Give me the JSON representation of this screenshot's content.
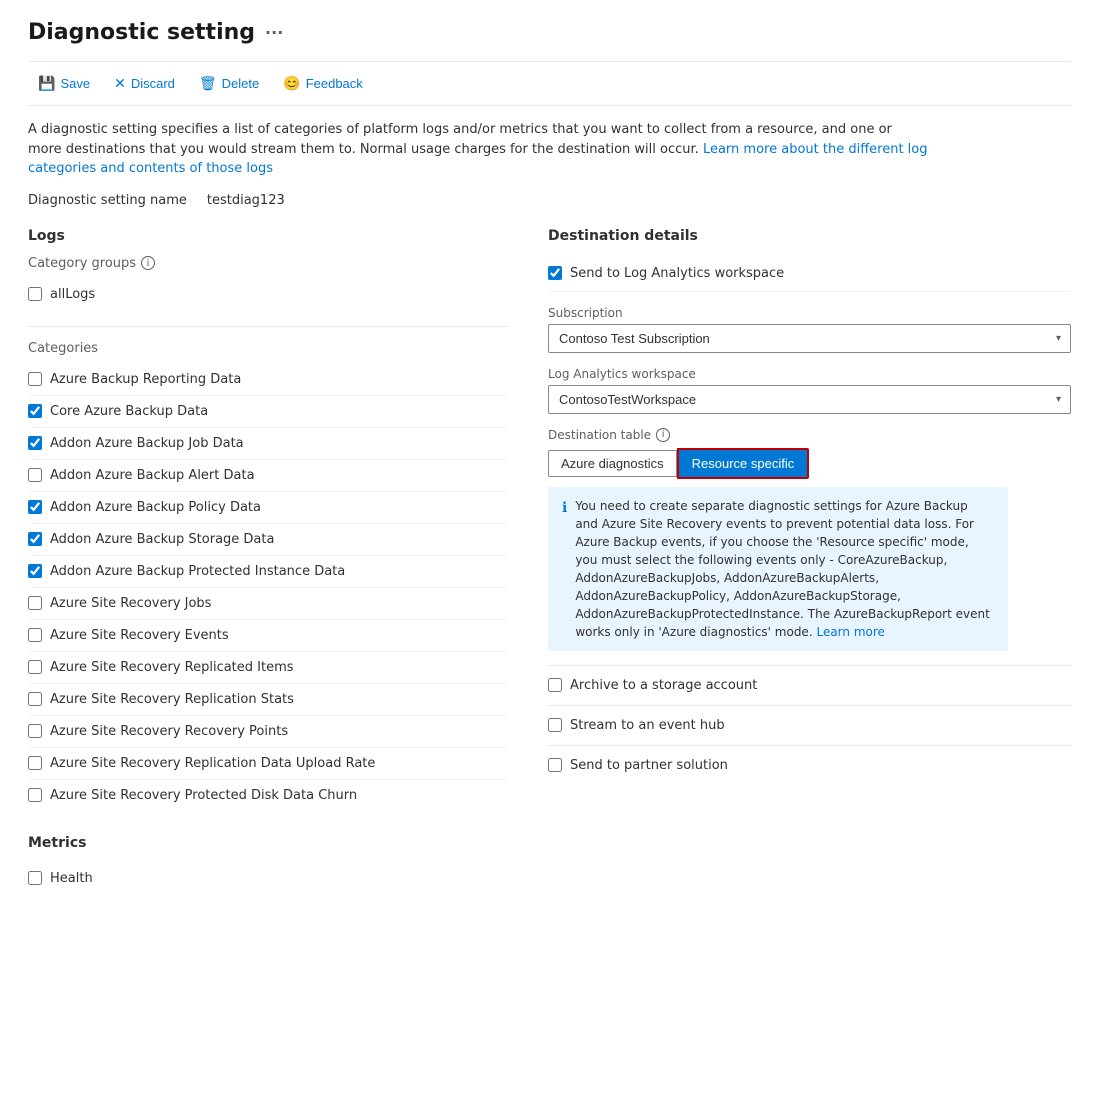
{
  "page": {
    "title": "Diagnostic setting",
    "ellipsis": "···"
  },
  "toolbar": {
    "save_label": "Save",
    "discard_label": "Discard",
    "delete_label": "Delete",
    "feedback_label": "Feedback"
  },
  "description": {
    "main_text": "A diagnostic setting specifies a list of categories of platform logs and/or metrics that you want to collect from a resource, and one or more destinations that you would stream them to. Normal usage charges for the destination will occur.",
    "link_text": "Learn more about the different log categories and contents of those logs"
  },
  "setting_name": {
    "label": "Diagnostic setting name",
    "value": "testdiag123"
  },
  "logs": {
    "section_title": "Logs",
    "category_groups_label": "Category groups",
    "all_logs_label": "allLogs",
    "all_logs_checked": false,
    "categories_label": "Categories",
    "categories": [
      {
        "id": "cat1",
        "label": "Azure Backup Reporting Data",
        "checked": false
      },
      {
        "id": "cat2",
        "label": "Core Azure Backup Data",
        "checked": true
      },
      {
        "id": "cat3",
        "label": "Addon Azure Backup Job Data",
        "checked": true
      },
      {
        "id": "cat4",
        "label": "Addon Azure Backup Alert Data",
        "checked": false
      },
      {
        "id": "cat5",
        "label": "Addon Azure Backup Policy Data",
        "checked": true
      },
      {
        "id": "cat6",
        "label": "Addon Azure Backup Storage Data",
        "checked": true
      },
      {
        "id": "cat7",
        "label": "Addon Azure Backup Protected Instance Data",
        "checked": true
      },
      {
        "id": "cat8",
        "label": "Azure Site Recovery Jobs",
        "checked": false
      },
      {
        "id": "cat9",
        "label": "Azure Site Recovery Events",
        "checked": false
      },
      {
        "id": "cat10",
        "label": "Azure Site Recovery Replicated Items",
        "checked": false
      },
      {
        "id": "cat11",
        "label": "Azure Site Recovery Replication Stats",
        "checked": false
      },
      {
        "id": "cat12",
        "label": "Azure Site Recovery Recovery Points",
        "checked": false
      },
      {
        "id": "cat13",
        "label": "Azure Site Recovery Replication Data Upload Rate",
        "checked": false
      },
      {
        "id": "cat14",
        "label": "Azure Site Recovery Protected Disk Data Churn",
        "checked": false
      }
    ]
  },
  "metrics": {
    "section_title": "Metrics",
    "items": [
      {
        "id": "m1",
        "label": "Health",
        "checked": false
      }
    ]
  },
  "destination": {
    "section_title": "Destination details",
    "send_to_log_analytics_label": "Send to Log Analytics workspace",
    "send_to_log_analytics_checked": true,
    "subscription_label": "Subscription",
    "subscription_value": "Contoso Test Subscription",
    "log_analytics_label": "Log Analytics workspace",
    "log_analytics_value": "ContosoTestWorkspace",
    "destination_table_label": "Destination table",
    "azure_diagnostics_label": "Azure diagnostics",
    "resource_specific_label": "Resource specific",
    "info_box_text": "You need to create separate diagnostic settings for Azure Backup and Azure Site Recovery events to prevent potential data loss. For Azure Backup events, if you choose the 'Resource specific' mode, you must select the following events only - CoreAzureBackup, AddonAzureBackupJobs, AddonAzureBackupAlerts, AddonAzureBackupPolicy, AddonAzureBackupStorage, AddonAzureBackupProtectedInstance. The AzureBackupReport event works only in 'Azure diagnostics' mode.",
    "learn_more_label": "Learn more",
    "archive_label": "Archive to a storage account",
    "archive_checked": false,
    "stream_label": "Stream to an event hub",
    "stream_checked": false,
    "partner_label": "Send to partner solution",
    "partner_checked": false
  }
}
